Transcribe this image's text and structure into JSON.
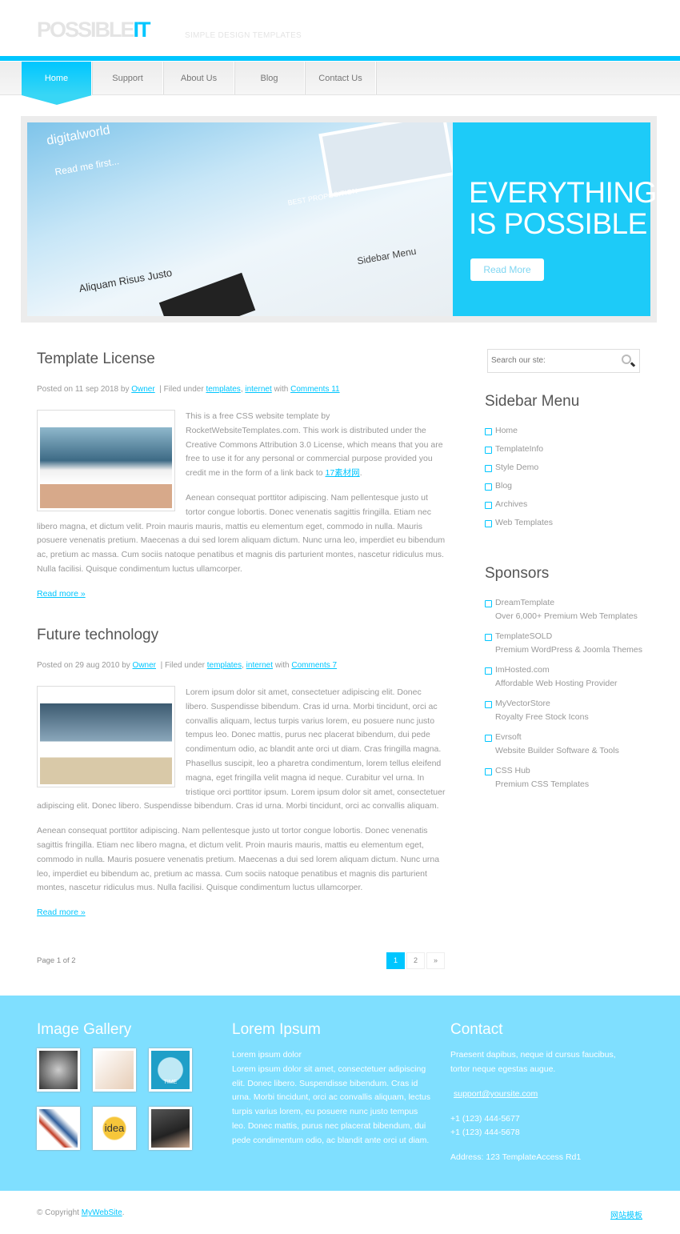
{
  "header": {
    "logo_main": "POSSIBLE",
    "logo_accent": "IT",
    "tagline": "SIMPLE DESIGN TEMPLATES"
  },
  "nav": [
    {
      "label": "Home",
      "active": true
    },
    {
      "label": "Support"
    },
    {
      "label": "About Us"
    },
    {
      "label": "Blog"
    },
    {
      "label": "Contact Us"
    }
  ],
  "hero": {
    "title_line1": "EVERYTHING",
    "title_line2": "IS POSSIBLE",
    "button": "Read More",
    "image_texts": {
      "brand": "digitalworld",
      "read": "Read me first...",
      "best": "BEST PROPOSITION",
      "sidebar": "Sidebar Menu",
      "post": "Aliquam Risus Justo"
    }
  },
  "posts": [
    {
      "title": "Template License",
      "meta_prefix": "Posted on 11 sep 2018 by",
      "author": "Owner",
      "filed": "| Filed under",
      "cat1": "templates",
      "comma": ",",
      "cat2": "internet",
      "with": "with",
      "comments": "Comments 11",
      "p1": "This is a free CSS website template by RocketWebsiteTemplates.com. This work is distributed under the Creative Commons Attribution 3.0 License, which means that you are free to use it for any personal or commercial purpose provided you credit me in the form of a link back to",
      "p1_link": "17素材网",
      "p1_end": ".",
      "p2": "Aenean consequat porttitor adipiscing. Nam pellentesque justo ut tortor congue lobortis. Donec venenatis sagittis fringilla. Etiam nec libero magna, et dictum velit. Proin mauris mauris, mattis eu elementum eget, commodo in nulla. Mauris posuere venenatis pretium. Maecenas a dui sed lorem aliquam dictum. Nunc urna leo, imperdiet eu bibendum ac, pretium ac massa. Cum sociis natoque penatibus et magnis dis parturient montes, nascetur ridiculus mus. Nulla facilisi. Quisque condimentum luctus ullamcorper.",
      "read_more": "Read more »"
    },
    {
      "title": "Future technology",
      "meta_prefix": "Posted on 29 aug 2010 by",
      "author": "Owner",
      "filed": "| Filed under",
      "cat1": "templates",
      "comma": ",",
      "cat2": "internet",
      "with": "with",
      "comments": "Comments 7",
      "p1": "Lorem ipsum dolor sit amet, consectetuer adipiscing elit. Donec libero. Suspendisse bibendum. Cras id urna. Morbi tincidunt, orci ac convallis aliquam, lectus turpis varius lorem, eu posuere nunc justo tempus leo. Donec mattis, purus nec placerat bibendum, dui pede condimentum odio, ac blandit ante orci ut diam. Cras fringilla magna. Phasellus suscipit, leo a pharetra condimentum, lorem tellus eleifend magna, eget fringilla velit magna id neque. Curabitur vel urna. In tristique orci porttitor ipsum. Lorem ipsum dolor sit amet, consectetuer adipiscing elit. Donec libero. Suspendisse bibendum. Cras id urna. Morbi tincidunt, orci ac convallis aliquam.",
      "p2": "Aenean consequat porttitor adipiscing. Nam pellentesque justo ut tortor congue lobortis. Donec venenatis sagittis fringilla. Etiam nec libero magna, et dictum velit. Proin mauris mauris, mattis eu elementum eget, commodo in nulla. Mauris posuere venenatis pretium. Maecenas a dui sed lorem aliquam dictum. Nunc urna leo, imperdiet eu bibendum ac, pretium ac massa. Cum sociis natoque penatibus et magnis dis parturient montes, nascetur ridiculus mus. Nulla facilisi. Quisque condimentum luctus ullamcorper.",
      "read_more": "Read more »"
    }
  ],
  "pagination": {
    "info": "Page 1 of 2",
    "pages": [
      "1",
      "2",
      "»"
    ],
    "current": "1"
  },
  "sidebar": {
    "search_placeholder": "Search our ste:",
    "menu_title": "Sidebar Menu",
    "menu": [
      "Home",
      "TemplateInfo",
      "Style Demo",
      "Blog",
      "Archives",
      "Web Templates"
    ],
    "sponsors_title": "Sponsors",
    "sponsors": [
      {
        "name": "DreamTemplate",
        "desc": "Over 6,000+ Premium Web Templates"
      },
      {
        "name": "TemplateSOLD",
        "desc": "Premium WordPress & Joomla Themes"
      },
      {
        "name": "ImHosted.com",
        "desc": "Affordable Web Hosting Provider"
      },
      {
        "name": "MyVectorStore",
        "desc": "Royalty Free Stock Icons"
      },
      {
        "name": "Evrsoft",
        "desc": "Website Builder Software & Tools"
      },
      {
        "name": "CSS Hub",
        "desc": "Premium CSS Templates"
      }
    ]
  },
  "footer": {
    "gallery_title": "Image Gallery",
    "lorem_title": "Lorem Ipsum",
    "lorem_line1": "Lorem ipsum dolor",
    "lorem_text": "Lorem ipsum dolor sit amet, consectetuer adipiscing elit. Donec libero. Suspendisse bibendum. Cras id urna. Morbi tincidunt, orci ac convallis aliquam, lectus turpis varius lorem, eu posuere nunc justo tempus leo. Donec mattis, purus nec placerat bibendum, dui pede condimentum odio, ac blandit ante orci ut diam.",
    "contact_title": "Contact",
    "contact_text": "Praesent dapibus, neque id cursus faucibus, tortor neque egestas augue.",
    "email": "support@yoursite.com",
    "phone1": "+1 (123) 444-5677",
    "phone2": "+1 (123) 444-5678",
    "address": "Address: 123 TemplateAccess Rd1",
    "gallery_labels": {
      "idea": "idea",
      "time": "TIME"
    }
  },
  "bottom": {
    "copyright": "© Copyright",
    "site_link": "MyWebSite",
    "period": ".",
    "right_link": "网站模板"
  },
  "colors": {
    "accent": "#00c6ff",
    "footer_bg": "#7fdfff",
    "hero_panel": "#1dcbf8"
  }
}
